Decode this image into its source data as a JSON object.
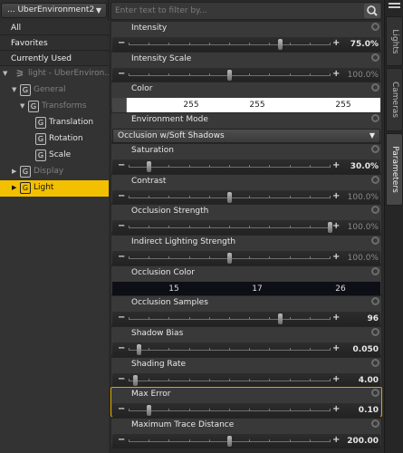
{
  "scene_dropdown": {
    "label": "... UberEnvironment2"
  },
  "left_nav": [
    {
      "label": "All"
    },
    {
      "label": "Favorites"
    },
    {
      "label": "Currently Used"
    }
  ],
  "tree": [
    {
      "label": "light - UberEnviron...",
      "type": "light"
    },
    {
      "label": "General",
      "icon": "G"
    },
    {
      "label": "Transforms",
      "icon": "G"
    },
    {
      "label": "Translation",
      "icon": "G"
    },
    {
      "label": "Rotation",
      "icon": "G"
    },
    {
      "label": "Scale",
      "icon": "G"
    },
    {
      "label": "Display",
      "icon": "G"
    },
    {
      "label": "Light",
      "icon": "G"
    }
  ],
  "filter": {
    "placeholder": "Enter text to filter by..."
  },
  "properties": [
    {
      "name": "Intensity",
      "kind": "slider",
      "value": "75.0%",
      "level": 0.75,
      "active": true
    },
    {
      "name": "Intensity Scale",
      "kind": "slider",
      "value": "100.0%",
      "level": 0.5,
      "active": false
    },
    {
      "name": "Color",
      "kind": "color",
      "values": [
        "255",
        "255",
        "255"
      ],
      "color": "#ffffff"
    },
    {
      "name": "Environment Mode",
      "kind": "select",
      "value": "Occlusion w/Soft Shadows"
    },
    {
      "name": "Saturation",
      "kind": "slider",
      "value": "30.0%",
      "level": 0.1,
      "active": true
    },
    {
      "name": "Contrast",
      "kind": "slider",
      "value": "100.0%",
      "level": 0.5,
      "active": false
    },
    {
      "name": "Occlusion Strength",
      "kind": "slider",
      "value": "100.0%",
      "level": 1.0,
      "active": false
    },
    {
      "name": "Indirect Lighting Strength",
      "kind": "slider",
      "value": "100.0%",
      "level": 0.5,
      "active": false
    },
    {
      "name": "Occlusion Color",
      "kind": "color",
      "values": [
        "15",
        "17",
        "26"
      ],
      "color": "#0f111a"
    },
    {
      "name": "Occlusion Samples",
      "kind": "slider",
      "value": "96",
      "level": 0.75,
      "active": true
    },
    {
      "name": "Shadow Bias",
      "kind": "slider",
      "value": "0.050",
      "level": 0.05,
      "active": true
    },
    {
      "name": "Shading Rate",
      "kind": "slider",
      "value": "4.00",
      "level": 0.03,
      "active": true
    },
    {
      "name": "Max Error",
      "kind": "slider",
      "value": "0.10",
      "level": 0.1,
      "active": true,
      "highlight": true
    },
    {
      "name": "Maximum Trace Distance",
      "kind": "slider",
      "value": "200.00",
      "level": 0.5,
      "active": true
    }
  ],
  "side_tabs": [
    {
      "label": "Lights"
    },
    {
      "label": "Cameras"
    },
    {
      "label": "Parameters"
    }
  ]
}
